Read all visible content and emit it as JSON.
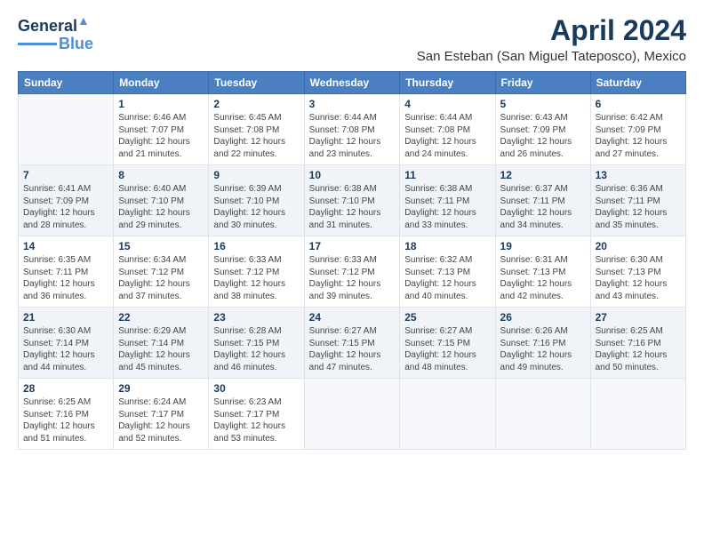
{
  "logo": {
    "line1": "General",
    "line2": "Blue",
    "tagline": ""
  },
  "title": "April 2024",
  "subtitle": "San Esteban (San Miguel Tateposco), Mexico",
  "days_of_week": [
    "Sunday",
    "Monday",
    "Tuesday",
    "Wednesday",
    "Thursday",
    "Friday",
    "Saturday"
  ],
  "weeks": [
    [
      {
        "day": "",
        "empty": true,
        "lines": []
      },
      {
        "day": "1",
        "lines": [
          "Sunrise: 6:46 AM",
          "Sunset: 7:07 PM",
          "Daylight: 12 hours",
          "and 21 minutes."
        ]
      },
      {
        "day": "2",
        "lines": [
          "Sunrise: 6:45 AM",
          "Sunset: 7:08 PM",
          "Daylight: 12 hours",
          "and 22 minutes."
        ]
      },
      {
        "day": "3",
        "lines": [
          "Sunrise: 6:44 AM",
          "Sunset: 7:08 PM",
          "Daylight: 12 hours",
          "and 23 minutes."
        ]
      },
      {
        "day": "4",
        "lines": [
          "Sunrise: 6:44 AM",
          "Sunset: 7:08 PM",
          "Daylight: 12 hours",
          "and 24 minutes."
        ]
      },
      {
        "day": "5",
        "lines": [
          "Sunrise: 6:43 AM",
          "Sunset: 7:09 PM",
          "Daylight: 12 hours",
          "and 26 minutes."
        ]
      },
      {
        "day": "6",
        "lines": [
          "Sunrise: 6:42 AM",
          "Sunset: 7:09 PM",
          "Daylight: 12 hours",
          "and 27 minutes."
        ]
      }
    ],
    [
      {
        "day": "7",
        "lines": [
          "Sunrise: 6:41 AM",
          "Sunset: 7:09 PM",
          "Daylight: 12 hours",
          "and 28 minutes."
        ]
      },
      {
        "day": "8",
        "lines": [
          "Sunrise: 6:40 AM",
          "Sunset: 7:10 PM",
          "Daylight: 12 hours",
          "and 29 minutes."
        ]
      },
      {
        "day": "9",
        "lines": [
          "Sunrise: 6:39 AM",
          "Sunset: 7:10 PM",
          "Daylight: 12 hours",
          "and 30 minutes."
        ]
      },
      {
        "day": "10",
        "lines": [
          "Sunrise: 6:38 AM",
          "Sunset: 7:10 PM",
          "Daylight: 12 hours",
          "and 31 minutes."
        ]
      },
      {
        "day": "11",
        "lines": [
          "Sunrise: 6:38 AM",
          "Sunset: 7:11 PM",
          "Daylight: 12 hours",
          "and 33 minutes."
        ]
      },
      {
        "day": "12",
        "lines": [
          "Sunrise: 6:37 AM",
          "Sunset: 7:11 PM",
          "Daylight: 12 hours",
          "and 34 minutes."
        ]
      },
      {
        "day": "13",
        "lines": [
          "Sunrise: 6:36 AM",
          "Sunset: 7:11 PM",
          "Daylight: 12 hours",
          "and 35 minutes."
        ]
      }
    ],
    [
      {
        "day": "14",
        "lines": [
          "Sunrise: 6:35 AM",
          "Sunset: 7:11 PM",
          "Daylight: 12 hours",
          "and 36 minutes."
        ]
      },
      {
        "day": "15",
        "lines": [
          "Sunrise: 6:34 AM",
          "Sunset: 7:12 PM",
          "Daylight: 12 hours",
          "and 37 minutes."
        ]
      },
      {
        "day": "16",
        "lines": [
          "Sunrise: 6:33 AM",
          "Sunset: 7:12 PM",
          "Daylight: 12 hours",
          "and 38 minutes."
        ]
      },
      {
        "day": "17",
        "lines": [
          "Sunrise: 6:33 AM",
          "Sunset: 7:12 PM",
          "Daylight: 12 hours",
          "and 39 minutes."
        ]
      },
      {
        "day": "18",
        "lines": [
          "Sunrise: 6:32 AM",
          "Sunset: 7:13 PM",
          "Daylight: 12 hours",
          "and 40 minutes."
        ]
      },
      {
        "day": "19",
        "lines": [
          "Sunrise: 6:31 AM",
          "Sunset: 7:13 PM",
          "Daylight: 12 hours",
          "and 42 minutes."
        ]
      },
      {
        "day": "20",
        "lines": [
          "Sunrise: 6:30 AM",
          "Sunset: 7:13 PM",
          "Daylight: 12 hours",
          "and 43 minutes."
        ]
      }
    ],
    [
      {
        "day": "21",
        "lines": [
          "Sunrise: 6:30 AM",
          "Sunset: 7:14 PM",
          "Daylight: 12 hours",
          "and 44 minutes."
        ]
      },
      {
        "day": "22",
        "lines": [
          "Sunrise: 6:29 AM",
          "Sunset: 7:14 PM",
          "Daylight: 12 hours",
          "and 45 minutes."
        ]
      },
      {
        "day": "23",
        "lines": [
          "Sunrise: 6:28 AM",
          "Sunset: 7:15 PM",
          "Daylight: 12 hours",
          "and 46 minutes."
        ]
      },
      {
        "day": "24",
        "lines": [
          "Sunrise: 6:27 AM",
          "Sunset: 7:15 PM",
          "Daylight: 12 hours",
          "and 47 minutes."
        ]
      },
      {
        "day": "25",
        "lines": [
          "Sunrise: 6:27 AM",
          "Sunset: 7:15 PM",
          "Daylight: 12 hours",
          "and 48 minutes."
        ]
      },
      {
        "day": "26",
        "lines": [
          "Sunrise: 6:26 AM",
          "Sunset: 7:16 PM",
          "Daylight: 12 hours",
          "and 49 minutes."
        ]
      },
      {
        "day": "27",
        "lines": [
          "Sunrise: 6:25 AM",
          "Sunset: 7:16 PM",
          "Daylight: 12 hours",
          "and 50 minutes."
        ]
      }
    ],
    [
      {
        "day": "28",
        "lines": [
          "Sunrise: 6:25 AM",
          "Sunset: 7:16 PM",
          "Daylight: 12 hours",
          "and 51 minutes."
        ]
      },
      {
        "day": "29",
        "lines": [
          "Sunrise: 6:24 AM",
          "Sunset: 7:17 PM",
          "Daylight: 12 hours",
          "and 52 minutes."
        ]
      },
      {
        "day": "30",
        "lines": [
          "Sunrise: 6:23 AM",
          "Sunset: 7:17 PM",
          "Daylight: 12 hours",
          "and 53 minutes."
        ]
      },
      {
        "day": "",
        "empty": true,
        "lines": []
      },
      {
        "day": "",
        "empty": true,
        "lines": []
      },
      {
        "day": "",
        "empty": true,
        "lines": []
      },
      {
        "day": "",
        "empty": true,
        "lines": []
      }
    ]
  ]
}
